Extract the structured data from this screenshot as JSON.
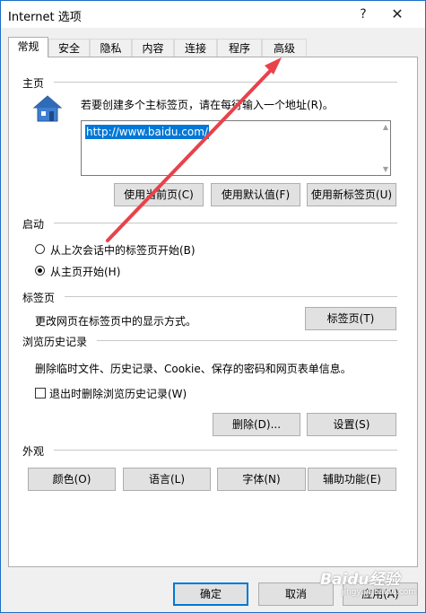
{
  "window": {
    "title": "Internet 选项",
    "help": "?",
    "close": "✕"
  },
  "tabs": [
    "常规",
    "安全",
    "隐私",
    "内容",
    "连接",
    "程序",
    "高级"
  ],
  "home": {
    "section": "主页",
    "instruction": "若要创建多个主标签页，请在每行输入一个地址(R)。",
    "url": "http://www.baidu.com/",
    "buttons": [
      "使用当前页(C)",
      "使用默认值(F)",
      "使用新标签页(U)"
    ]
  },
  "startup": {
    "section": "启动",
    "option1": "从上次会话中的标签页开始(B)",
    "option2": "从主页开始(H)"
  },
  "tabs_section": {
    "section": "标签页",
    "desc": "更改网页在标签页中的显示方式。",
    "button": "标签页(T)"
  },
  "history": {
    "section": "浏览历史记录",
    "desc": "删除临时文件、历史记录、Cookie、保存的密码和网页表单信息。",
    "checkbox": "退出时删除浏览历史记录(W)",
    "delete": "删除(D)...",
    "settings": "设置(S)"
  },
  "appearance": {
    "section": "外观",
    "buttons": [
      "颜色(O)",
      "语言(L)",
      "字体(N)",
      "辅助功能(E)"
    ]
  },
  "footer": {
    "ok": "确定",
    "cancel": "取消",
    "apply": "应用(A)"
  },
  "watermark": {
    "main": "Baidu经验",
    "sub": "jingyan.baidu.com"
  },
  "colors": {
    "accent": "#0078d7",
    "arrow": "#e8424a"
  }
}
